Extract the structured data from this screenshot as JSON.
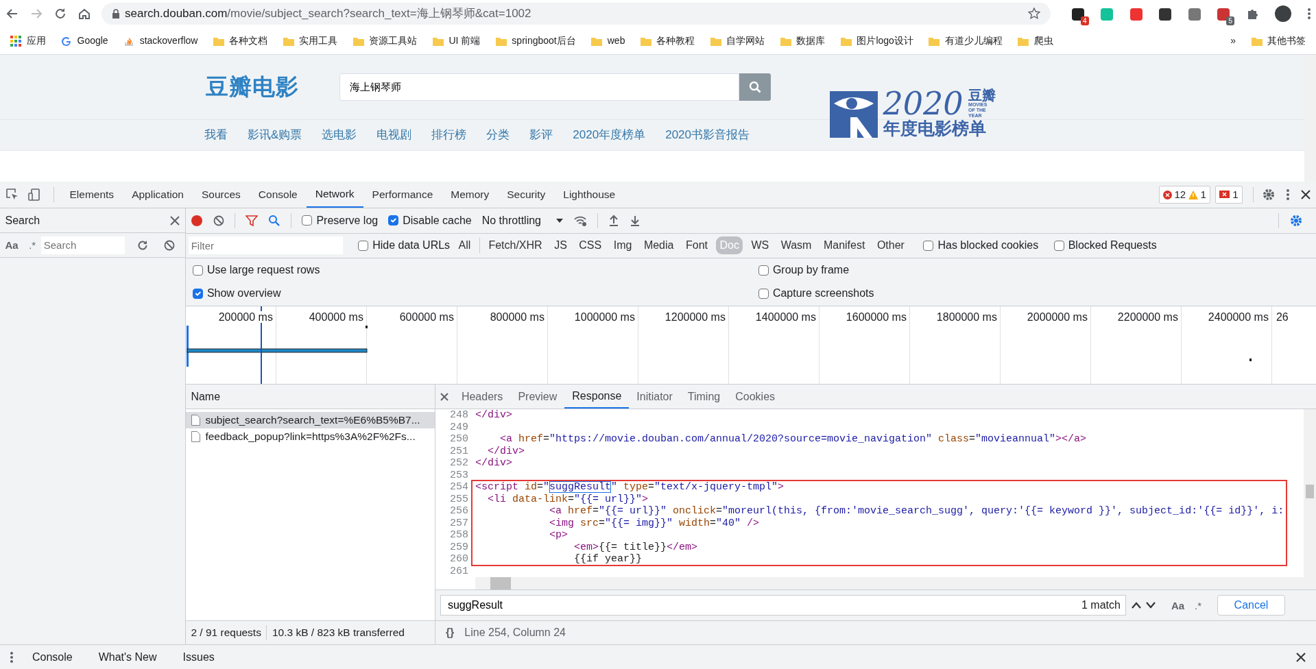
{
  "browser": {
    "address": {
      "host": "search.douban.com",
      "path": "/movie/subject_search?search_text=海上钢琴师&cat=1002"
    },
    "extension_badges": [
      "4",
      "5"
    ],
    "bookmarks": [
      {
        "label": "应用",
        "kind": "apps"
      },
      {
        "label": "Google",
        "kind": "google"
      },
      {
        "label": "stackoverflow",
        "kind": "stack"
      },
      {
        "label": "各种文档",
        "kind": "folder"
      },
      {
        "label": "实用工具",
        "kind": "folder"
      },
      {
        "label": "资源工具站",
        "kind": "folder"
      },
      {
        "label": "UI 前端",
        "kind": "folder"
      },
      {
        "label": "springboot后台",
        "kind": "folder"
      },
      {
        "label": "web",
        "kind": "folder"
      },
      {
        "label": "各种教程",
        "kind": "folder"
      },
      {
        "label": "自学网站",
        "kind": "folder"
      },
      {
        "label": "数据库",
        "kind": "folder"
      },
      {
        "label": "图片logo设计",
        "kind": "folder"
      },
      {
        "label": "有道少儿编程",
        "kind": "folder"
      },
      {
        "label": "爬虫",
        "kind": "folder"
      }
    ],
    "more": "»",
    "other_bookmarks": "其他书签"
  },
  "page": {
    "logo": "豆瓣电影",
    "search": {
      "value": "海上钢琴师"
    },
    "nav": [
      "我看",
      "影讯&购票",
      "选电影",
      "电视剧",
      "排行榜",
      "分类",
      "影评",
      "2020年度榜单",
      "2020书影音报告"
    ],
    "banner": {
      "year": "2020",
      "brand": "豆瓣",
      "tagline": "MOVIES OF THE YEAR",
      "title": "年度电影榜单"
    }
  },
  "devtools": {
    "tabs": [
      {
        "label": "Elements",
        "selected": false
      },
      {
        "label": "Application",
        "selected": false
      },
      {
        "label": "Sources",
        "selected": false
      },
      {
        "label": "Console",
        "selected": false
      },
      {
        "label": "Network",
        "selected": true
      },
      {
        "label": "Performance",
        "selected": false
      },
      {
        "label": "Memory",
        "selected": false
      },
      {
        "label": "Security",
        "selected": false
      },
      {
        "label": "Lighthouse",
        "selected": false
      }
    ],
    "errors": "12",
    "warnings": "1",
    "issues": "1",
    "search_panel": {
      "title": "Search",
      "case_label": "Aa",
      "regex_label": ".*",
      "placeholder": "Search"
    },
    "toolbar": {
      "recording": true,
      "preserve_log": {
        "label": "Preserve log",
        "checked": false
      },
      "disable_cache": {
        "label": "Disable cache",
        "checked": true
      },
      "throttling": "No throttling"
    },
    "filter": {
      "placeholder": "Filter",
      "hide_data_urls": {
        "label": "Hide data URLs",
        "checked": false
      },
      "types": [
        {
          "label": "All",
          "selected": false
        },
        {
          "label": "Fetch/XHR",
          "selected": false
        },
        {
          "label": "JS",
          "selected": false
        },
        {
          "label": "CSS",
          "selected": false
        },
        {
          "label": "Img",
          "selected": false
        },
        {
          "label": "Media",
          "selected": false
        },
        {
          "label": "Font",
          "selected": false
        },
        {
          "label": "Doc",
          "selected": true
        },
        {
          "label": "WS",
          "selected": false
        },
        {
          "label": "Wasm",
          "selected": false
        },
        {
          "label": "Manifest",
          "selected": false
        },
        {
          "label": "Other",
          "selected": false
        }
      ],
      "has_blocked_cookies": {
        "label": "Has blocked cookies",
        "checked": false
      },
      "blocked_requests": {
        "label": "Blocked Requests",
        "checked": false
      }
    },
    "options": [
      {
        "label": "Use large request rows",
        "checked": false
      },
      {
        "label": "Group by frame",
        "checked": false
      },
      {
        "label": "Show overview",
        "checked": true
      },
      {
        "label": "Capture screenshots",
        "checked": false
      }
    ],
    "timeline": {
      "ticks": [
        "200000 ms",
        "400000 ms",
        "600000 ms",
        "800000 ms",
        "1000000 ms",
        "1200000 ms",
        "1400000 ms",
        "1600000 ms",
        "1800000 ms",
        "2000000 ms",
        "2200000 ms",
        "2400000 ms",
        "26"
      ]
    },
    "requests": {
      "column": "Name",
      "rows": [
        {
          "name": "subject_search?search_text=%E6%B5%B7...",
          "selected": true
        },
        {
          "name": "feedback_popup?link=https%3A%2F%2Fs...",
          "selected": false
        }
      ]
    },
    "detail_tabs": [
      {
        "label": "Headers",
        "selected": false
      },
      {
        "label": "Preview",
        "selected": false
      },
      {
        "label": "Response",
        "selected": true
      },
      {
        "label": "Initiator",
        "selected": false
      },
      {
        "label": "Timing",
        "selected": false
      },
      {
        "label": "Cookies",
        "selected": false
      }
    ],
    "code": {
      "lines": [
        {
          "number": "248",
          "tokens": [
            {
              "kind": "tag",
              "text": "</div>"
            }
          ]
        },
        {
          "number": "249"
        },
        {
          "number": "250",
          "tokens": [
            {
              "kind": "tag",
              "text": "    <a "
            },
            {
              "kind": "attr",
              "text": "href"
            },
            {
              "kind": "text",
              "text": "="
            },
            {
              "kind": "value",
              "text": "\"https://movie.douban.com/annual/2020?source=movie_navigation\""
            },
            {
              "kind": "attr",
              "text": " class"
            },
            {
              "kind": "text",
              "text": "="
            },
            {
              "kind": "value",
              "text": "\"movieannual\""
            },
            {
              "kind": "tag",
              "text": "></a>"
            }
          ]
        },
        {
          "number": "251",
          "tokens": [
            {
              "kind": "tag",
              "text": "  </div>"
            }
          ]
        },
        {
          "number": "252",
          "tokens": [
            {
              "kind": "tag",
              "text": "</div>"
            }
          ]
        },
        {
          "number": "253"
        },
        {
          "number": "254",
          "tokens": [
            {
              "kind": "tag",
              "text": "<script "
            },
            {
              "kind": "attr",
              "text": "id"
            },
            {
              "kind": "text",
              "text": "="
            },
            {
              "kind": "value",
              "text": "\""
            },
            {
              "kind": "match",
              "text": "suggResult"
            },
            {
              "kind": "value",
              "text": "\""
            },
            {
              "kind": "attr",
              "text": " type"
            },
            {
              "kind": "text",
              "text": "="
            },
            {
              "kind": "value",
              "text": "\"text/x-jquery-tmpl\""
            },
            {
              "kind": "tag",
              "text": ">"
            }
          ]
        },
        {
          "number": "255",
          "tokens": [
            {
              "kind": "tag",
              "text": "  <li "
            },
            {
              "kind": "attr",
              "text": "data-link"
            },
            {
              "kind": "text",
              "text": "="
            },
            {
              "kind": "value",
              "text": "\"{{= url}}\""
            },
            {
              "kind": "tag",
              "text": ">"
            }
          ]
        },
        {
          "number": "256",
          "tokens": [
            {
              "kind": "tag",
              "text": "            <a "
            },
            {
              "kind": "attr",
              "text": "href"
            },
            {
              "kind": "text",
              "text": "="
            },
            {
              "kind": "value",
              "text": "\"{{= url}}\""
            },
            {
              "kind": "attr",
              "text": " onclick"
            },
            {
              "kind": "text",
              "text": "="
            },
            {
              "kind": "value",
              "text": "\"moreurl(this, {from:'movie_search_sugg', query:'{{= keyword }}', subject_id:'{{= id}}', i:"
            }
          ]
        },
        {
          "number": "257",
          "tokens": [
            {
              "kind": "tag",
              "text": "            <img "
            },
            {
              "kind": "attr",
              "text": "src"
            },
            {
              "kind": "text",
              "text": "="
            },
            {
              "kind": "value",
              "text": "\"{{= img}}\""
            },
            {
              "kind": "attr",
              "text": " width"
            },
            {
              "kind": "text",
              "text": "="
            },
            {
              "kind": "value",
              "text": "\"40\""
            },
            {
              "kind": "tag",
              "text": " />"
            }
          ]
        },
        {
          "number": "258",
          "tokens": [
            {
              "kind": "tag",
              "text": "            <p>"
            }
          ]
        },
        {
          "number": "259",
          "tokens": [
            {
              "kind": "tag",
              "text": "                <em>"
            },
            {
              "kind": "text",
              "text": "{{= title}}"
            },
            {
              "kind": "tag",
              "text": "</em>"
            }
          ]
        },
        {
          "number": "260",
          "tokens": [
            {
              "kind": "text",
              "text": "                {{if year}}"
            }
          ]
        },
        {
          "number": "261"
        }
      ]
    },
    "find": {
      "value": "suggResult",
      "count": "1 match",
      "case_label": "Aa",
      "regex_label": ".*",
      "cancel": "Cancel"
    },
    "summary": {
      "requests": "2 / 91 requests",
      "transferred": "10.3 kB / 823 kB transferred"
    },
    "cursor": {
      "braces": "{}",
      "position": "Line 254, Column 24"
    },
    "drawer": {
      "tabs": [
        "Console",
        "What's New",
        "Issues"
      ]
    }
  }
}
